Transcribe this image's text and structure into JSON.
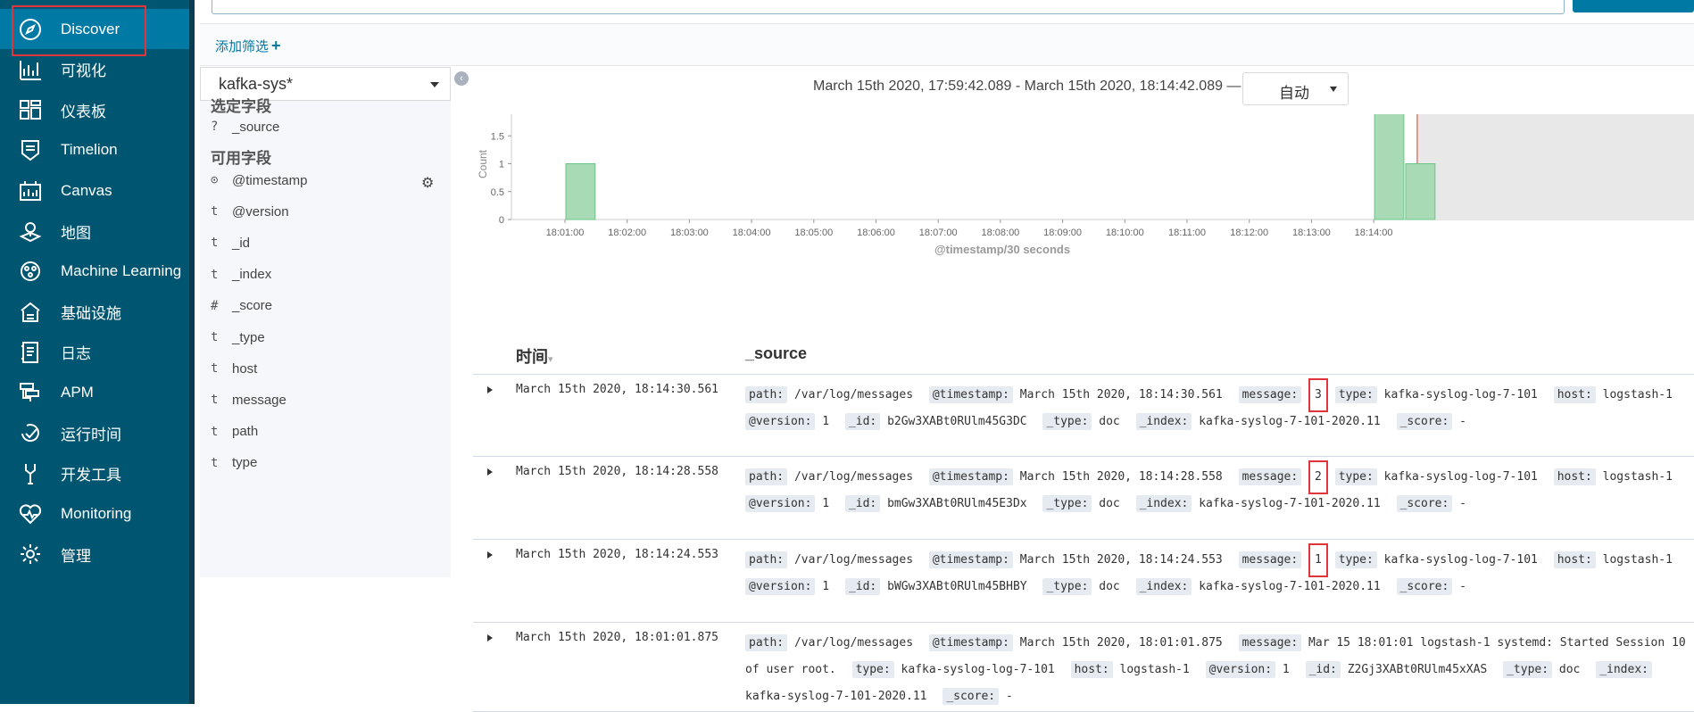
{
  "nav": {
    "items": [
      {
        "label": "Discover",
        "icon": "compass-icon"
      },
      {
        "label": "可视化",
        "icon": "visualize-icon"
      },
      {
        "label": "仪表板",
        "icon": "dashboard-icon"
      },
      {
        "label": "Timelion",
        "icon": "timelion-icon"
      },
      {
        "label": "Canvas",
        "icon": "canvas-icon"
      },
      {
        "label": "地图",
        "icon": "map-icon"
      },
      {
        "label": "Machine Learning",
        "icon": "ml-icon"
      },
      {
        "label": "基础设施",
        "icon": "infrastructure-icon"
      },
      {
        "label": "日志",
        "icon": "logs-icon"
      },
      {
        "label": "APM",
        "icon": "apm-icon"
      },
      {
        "label": "运行时间",
        "icon": "uptime-icon"
      },
      {
        "label": "开发工具",
        "icon": "devtools-icon"
      },
      {
        "label": "Monitoring",
        "icon": "monitoring-icon"
      },
      {
        "label": "管理",
        "icon": "gear-icon"
      }
    ],
    "active_index": 0,
    "accent": "#0079a5",
    "highlight_color": "#e0353b"
  },
  "filter": {
    "add_label": "添加筛选",
    "plus": "+"
  },
  "sidebar": {
    "index_pattern": "kafka-sys*",
    "selected_title": "选定字段",
    "selected_fields": [
      {
        "type": "?",
        "name": "_source"
      }
    ],
    "available_title": "可用字段",
    "available_fields": [
      {
        "type": "⊙",
        "name": "@timestamp"
      },
      {
        "type": "t",
        "name": "@version"
      },
      {
        "type": "t",
        "name": "_id"
      },
      {
        "type": "t",
        "name": "_index"
      },
      {
        "type": "#",
        "name": "_score"
      },
      {
        "type": "t",
        "name": "_type"
      },
      {
        "type": "t",
        "name": "host"
      },
      {
        "type": "t",
        "name": "message"
      },
      {
        "type": "t",
        "name": "path"
      },
      {
        "type": "t",
        "name": "type"
      }
    ]
  },
  "time_range": "March 15th 2020, 17:59:42.089 - March 15th 2020, 18:14:42.089 —",
  "interval": "自动",
  "chart_data": {
    "type": "bar",
    "ylabel": "Count",
    "xlabel": "@timestamp/30 seconds",
    "ylim": [
      0,
      2
    ],
    "yticks": [
      "0",
      "0.5",
      "1",
      "1.5",
      "2"
    ],
    "xticks": [
      "18:01:00",
      "18:02:00",
      "18:03:00",
      "18:04:00",
      "18:05:00",
      "18:06:00",
      "18:07:00",
      "18:08:00",
      "18:09:00",
      "18:10:00",
      "18:11:00",
      "18:12:00",
      "18:13:00",
      "18:14:00"
    ],
    "bars": [
      {
        "start": "18:01:00",
        "value": 1
      },
      {
        "start": "18:14:00",
        "value": 2
      },
      {
        "start": "18:14:30",
        "value": 1
      }
    ],
    "bar_color": "#a8dbb5",
    "now_marker_color": "#e07a6a"
  },
  "table": {
    "headers": {
      "time": "时间",
      "source": "_source"
    },
    "rows": [
      {
        "time": "March 15th 2020, 18:14:30.561",
        "line1": [
          [
            "path:",
            "/var/log/messages"
          ],
          [
            "@timestamp:",
            "March 15th 2020, 18:14:30.561"
          ],
          [
            "message:",
            "3",
            "box"
          ],
          [
            "type:",
            "kafka-syslog-log-7-101"
          ],
          [
            "host:",
            "logstash-1"
          ]
        ],
        "line2": [
          [
            "@version:",
            "1"
          ],
          [
            "_id:",
            "b2Gw3XABt0RUlm45G3DC"
          ],
          [
            "_type:",
            "doc"
          ],
          [
            "_index:",
            "kafka-syslog-7-101-2020.11"
          ],
          [
            "_score:",
            "-"
          ]
        ]
      },
      {
        "time": "March 15th 2020, 18:14:28.558",
        "line1": [
          [
            "path:",
            "/var/log/messages"
          ],
          [
            "@timestamp:",
            "March 15th 2020, 18:14:28.558"
          ],
          [
            "message:",
            "2",
            "box"
          ],
          [
            "type:",
            "kafka-syslog-log-7-101"
          ],
          [
            "host:",
            "logstash-1"
          ]
        ],
        "line2": [
          [
            "@version:",
            "1"
          ],
          [
            "_id:",
            "bmGw3XABt0RUlm45E3Dx"
          ],
          [
            "_type:",
            "doc"
          ],
          [
            "_index:",
            "kafka-syslog-7-101-2020.11"
          ],
          [
            "_score:",
            "-"
          ]
        ]
      },
      {
        "time": "March 15th 2020, 18:14:24.553",
        "line1": [
          [
            "path:",
            "/var/log/messages"
          ],
          [
            "@timestamp:",
            "March 15th 2020, 18:14:24.553"
          ],
          [
            "message:",
            "1",
            "box"
          ],
          [
            "type:",
            "kafka-syslog-log-7-101"
          ],
          [
            "host:",
            "logstash-1"
          ]
        ],
        "line2": [
          [
            "@version:",
            "1"
          ],
          [
            "_id:",
            "bWGw3XABt0RUlm45BHBY"
          ],
          [
            "_type:",
            "doc"
          ],
          [
            "_index:",
            "kafka-syslog-7-101-2020.11"
          ],
          [
            "_score:",
            "-"
          ]
        ]
      },
      {
        "time": "March 15th 2020, 18:01:01.875",
        "line1": [
          [
            "path:",
            "/var/log/messages"
          ],
          [
            "@timestamp:",
            "March 15th 2020, 18:01:01.875"
          ],
          [
            "message:",
            "Mar 15 18:01:01 logstash-1 systemd: Started Session 10 of user root."
          ],
          [
            "type:",
            "kafka-syslog-log-7-101"
          ],
          [
            "host:",
            "logstash-1"
          ],
          [
            "@version:",
            "1"
          ],
          [
            "_id:",
            "Z2Gj3XABt0RUlm45xXAS"
          ],
          [
            "_type:",
            "doc"
          ],
          [
            "_index:",
            "kafka-syslog-7-101-2020.11"
          ],
          [
            "_score:",
            "-"
          ]
        ],
        "line2": []
      }
    ]
  }
}
